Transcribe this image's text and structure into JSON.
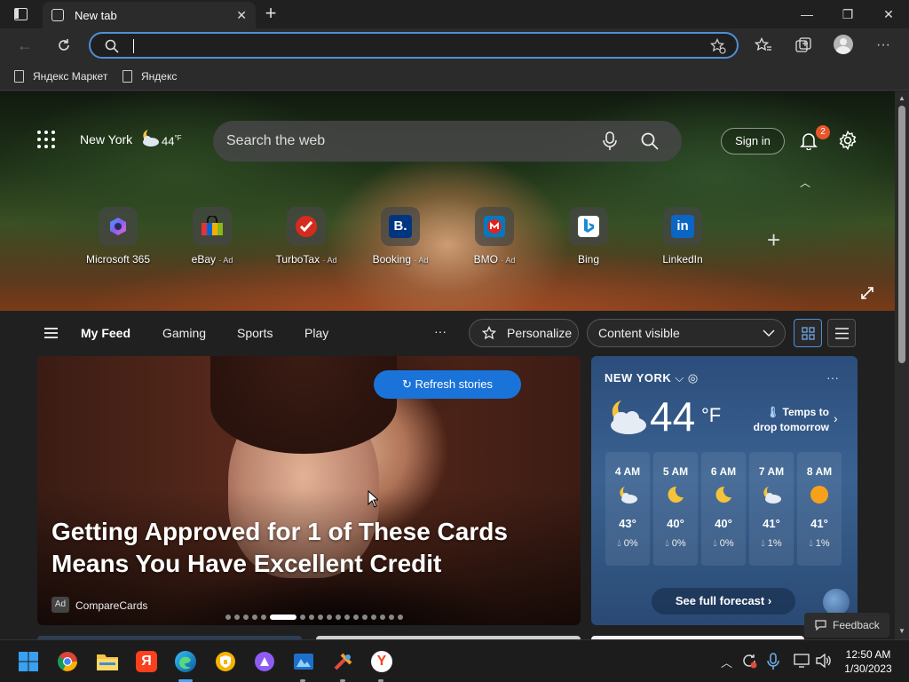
{
  "browser": {
    "tab_title": "New tab",
    "tab_close": "✕",
    "new_tab": "+",
    "window_min": "—",
    "window_restore": "❐",
    "window_close": "✕",
    "address_value": ""
  },
  "favorites": [
    {
      "label": "Яндекс Маркет"
    },
    {
      "label": "Яндекс"
    }
  ],
  "hero": {
    "location": "New York",
    "temperature": "44",
    "temp_unit": "°F",
    "search_placeholder": "Search the web",
    "sign_in": "Sign in",
    "notification_count": "2",
    "collapse_glyph": "︿",
    "add_tile": "+",
    "tiles": [
      {
        "label": "Microsoft 365",
        "ad": ""
      },
      {
        "label": "eBay",
        "ad": "· Ad"
      },
      {
        "label": "TurboTax",
        "ad": "· Ad"
      },
      {
        "label": "Booking",
        "ad": "· Ad"
      },
      {
        "label": "BMO",
        "ad": "· Ad"
      },
      {
        "label": "Bing",
        "ad": ""
      },
      {
        "label": "LinkedIn",
        "ad": ""
      }
    ]
  },
  "feed_nav": {
    "items": [
      "My Feed",
      "Gaming",
      "Sports",
      "Play"
    ],
    "more": "···",
    "personalize": "Personalize",
    "content_visible": "Content visible"
  },
  "main_card": {
    "refresh": "Refresh stories",
    "headline": "Getting Approved for 1 of These Cards Means You Have Excellent Credit",
    "ad_tag": "Ad",
    "source": "CompareCards",
    "carousel_count": 18,
    "carousel_active": 5
  },
  "weather": {
    "city": "NEW YORK",
    "temp": "44",
    "unit": "°F",
    "note": "Temps to drop tomorrow",
    "more": "···",
    "hours": [
      {
        "time": "4 AM",
        "icon": "moon-cloud",
        "temp": "43°",
        "precip": "0%"
      },
      {
        "time": "5 AM",
        "icon": "moon",
        "temp": "40°",
        "precip": "0%"
      },
      {
        "time": "6 AM",
        "icon": "moon",
        "temp": "40°",
        "precip": "0%"
      },
      {
        "time": "7 AM",
        "icon": "moon-cloud",
        "temp": "41°",
        "precip": "1%"
      },
      {
        "time": "8 AM",
        "icon": "sun",
        "temp": "41°",
        "precip": "1%"
      }
    ],
    "forecast_btn": "See full forecast ›"
  },
  "feedback": "Feedback",
  "taskbar": {
    "time": "12:50 AM",
    "date": "1/30/2023",
    "pinned": [
      "start",
      "chrome",
      "file-explorer",
      "yandex-browser",
      "edge",
      "security-app",
      "alice",
      "unknown-app",
      "settings-app",
      "yandex"
    ]
  },
  "colors": {
    "accent": "#1a73d9",
    "badge": "#e8562a",
    "address_focus": "#4f8fd6"
  }
}
